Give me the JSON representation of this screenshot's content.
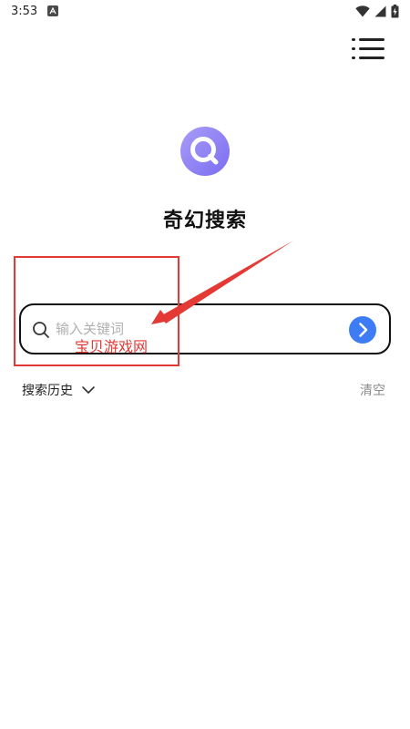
{
  "status_bar": {
    "time": "3:53",
    "icons": [
      "app-notification-icon",
      "wifi-icon",
      "signal-icon",
      "battery-charging-icon"
    ]
  },
  "header": {
    "menu_icon": "menu-list-icon"
  },
  "logo": {
    "icon": "search-logo-icon",
    "colors": [
      "#a99cf8",
      "#7b6df0"
    ]
  },
  "app": {
    "title": "奇幻搜索"
  },
  "search": {
    "placeholder": "输入关键词",
    "value": "",
    "submit_icon": "chevron-right-icon",
    "submit_color": "#3d7cf4"
  },
  "watermark": {
    "text": "宝贝游戏网",
    "color": "#e53935"
  },
  "history": {
    "label": "搜索历史",
    "toggle_icon": "chevron-down-icon",
    "clear_label": "清空"
  }
}
